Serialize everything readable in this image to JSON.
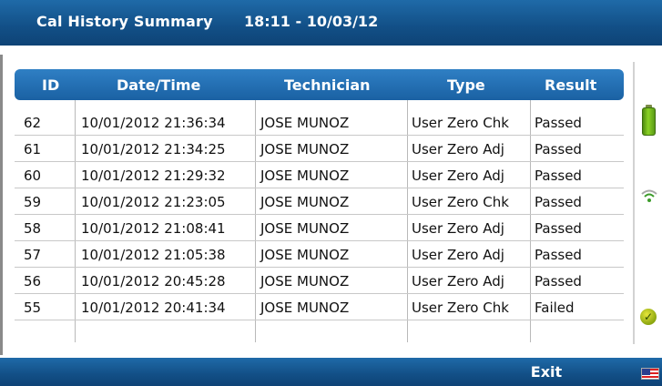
{
  "titlebar": {
    "title": "Cal History Summary",
    "datetime": "18:11 - 10/03/12"
  },
  "table": {
    "headers": {
      "id": "ID",
      "datetime": "Date/Time",
      "technician": "Technician",
      "type": "Type",
      "result": "Result"
    },
    "rows": [
      {
        "id": "62",
        "datetime": "10/01/2012 21:36:34",
        "technician": "JOSE MUNOZ",
        "type": "User Zero Chk",
        "result": "Passed"
      },
      {
        "id": "61",
        "datetime": "10/01/2012 21:34:25",
        "technician": "JOSE MUNOZ",
        "type": "User Zero Adj",
        "result": "Passed"
      },
      {
        "id": "60",
        "datetime": "10/01/2012 21:29:32",
        "technician": "JOSE MUNOZ",
        "type": "User Zero Adj",
        "result": "Passed"
      },
      {
        "id": "59",
        "datetime": "10/01/2012 21:23:05",
        "technician": "JOSE MUNOZ",
        "type": "User Zero Chk",
        "result": "Passed"
      },
      {
        "id": "58",
        "datetime": "10/01/2012 21:08:41",
        "technician": "JOSE MUNOZ",
        "type": "User Zero Adj",
        "result": "Passed"
      },
      {
        "id": "57",
        "datetime": "10/01/2012 21:05:38",
        "technician": "JOSE MUNOZ",
        "type": "User Zero Adj",
        "result": "Passed"
      },
      {
        "id": "56",
        "datetime": "10/01/2012 20:45:28",
        "technician": "JOSE MUNOZ",
        "type": "User Zero Adj",
        "result": "Passed"
      },
      {
        "id": "55",
        "datetime": "10/01/2012 20:41:34",
        "technician": "JOSE MUNOZ",
        "type": "User Zero Chk",
        "result": "Failed"
      }
    ]
  },
  "sidebar": {
    "icons": [
      "battery-icon",
      "wifi-icon",
      "check-status-icon"
    ]
  },
  "bottombar": {
    "exit_label": "Exit",
    "flag_icon": "us-flag-icon"
  },
  "colors": {
    "bar_blue": "#124f86",
    "header_blue": "#2570b4",
    "battery_green": "#8bd226"
  }
}
